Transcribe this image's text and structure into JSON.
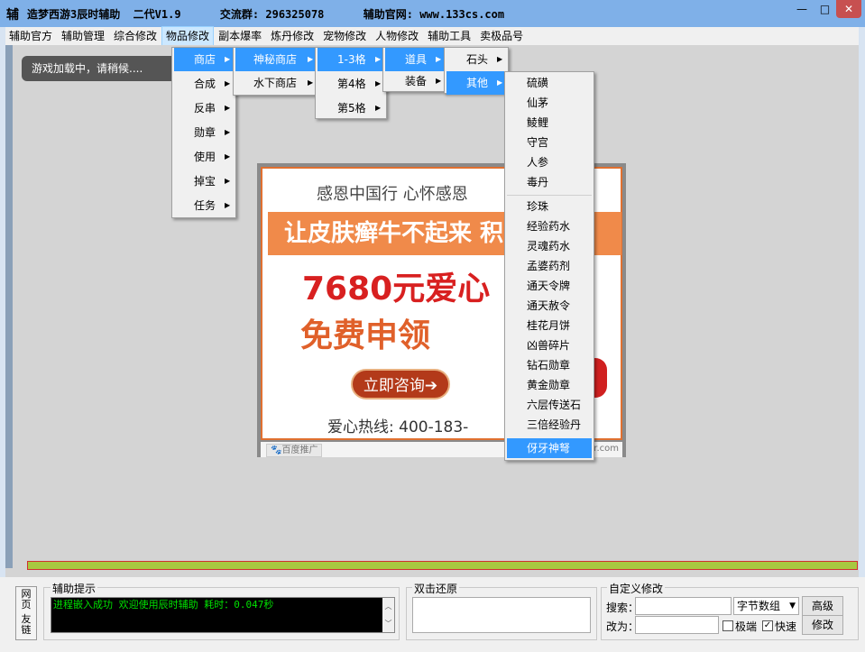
{
  "window": {
    "icon_char": "辅",
    "title": "造梦西游3辰时辅助  二代V1.9      交流群: 296325078      辅助官网: www.133cs.com",
    "min_glyph": "—",
    "max_glyph": "□",
    "close_glyph": "✕"
  },
  "menubar": {
    "items": [
      "辅助官方",
      "辅助管理",
      "综合修改",
      "物品修改",
      "副本爆率",
      "炼丹修改",
      "宠物修改",
      "人物修改",
      "辅助工具",
      "卖极品号"
    ],
    "active": "物品修改"
  },
  "loading_toast": "游戏加载中，请稍候....",
  "ad": {
    "slogan": "感恩中国行   心怀感恩",
    "banner": "让皮肤癣牛不起来 积",
    "price": "7680元爱心",
    "free": "免费申领",
    "button": "立即咨询➔",
    "hotline": "爱心热线: 400-183-",
    "badge": "🐾百度推广",
    "domain": "er.com"
  },
  "menus": {
    "level1": [
      "商店",
      "合成",
      "反串",
      "勋章",
      "使用",
      "掉宝",
      "任务"
    ],
    "level2": [
      "神秘商店",
      "水下商店"
    ],
    "level3": [
      "1-3格",
      "第4格",
      "第5格"
    ],
    "level4": [
      "道具",
      "装备"
    ],
    "level5": [
      "石头",
      "其他"
    ],
    "level6_group1": [
      "硫磺",
      "仙茅",
      "鲮鲤",
      "守宫",
      "人参",
      "毒丹"
    ],
    "level6_group2": [
      "珍珠",
      "经验药水",
      "灵魂药水",
      "孟婆药剂",
      "通天令牌",
      "通天赦令",
      "桂花月饼",
      "凶兽碎片",
      "钻石勋章",
      "黄金勋章",
      "六层传送石",
      "三倍经验丹",
      "伢牙神弩"
    ],
    "arrow": "▶"
  },
  "bottom": {
    "side_link_1": "网页",
    "side_link_2": "友链",
    "assist_label": "辅助提示",
    "log_text": "进程嵌入成功 欢迎使用辰时辅助 耗时：0.047秒",
    "restore_label": "双击还原",
    "custom_label": "自定义修改",
    "search_label": "搜索：",
    "change_label": "改为：",
    "search_value": "",
    "change_value": "",
    "type_select": "字节数组",
    "advanced_button": "高级",
    "modify_button": "修改",
    "extreme_label": "极端",
    "extreme_checked": false,
    "fast_label": "快速",
    "fast_checked": true,
    "check_glyph": "✓",
    "scroll_up": "︿",
    "scroll_down": "﹀"
  }
}
